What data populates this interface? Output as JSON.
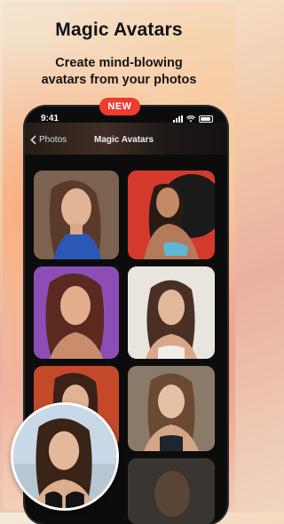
{
  "headline": "Magic Avatars",
  "subheadline_line1": "Create mind-blowing",
  "subheadline_line2": "avatars from your photos",
  "badge": "NEW",
  "status_bar": {
    "time": "9:41"
  },
  "nav": {
    "back_label": "Photos",
    "title": "Magic Avatars"
  },
  "icons": [
    "chevron-left-icon",
    "signal-icon",
    "wifi-icon",
    "battery-icon"
  ],
  "colors": {
    "badge": "#ee3b2f",
    "phone": "#0c0c0c"
  }
}
